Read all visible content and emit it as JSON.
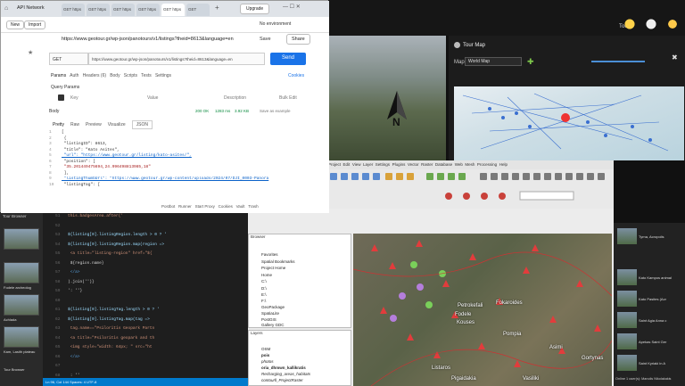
{
  "tour_app": {
    "tools_label": "Tools",
    "tour_map_title": "Tour Map",
    "map_label": "Map",
    "map_select_value": "World Map",
    "north_letter": "N"
  },
  "chrome": {
    "tabs": [
      "GET https",
      "GET https",
      "GET https",
      "GET https",
      "GET https",
      "GET"
    ],
    "workspace": "API Network",
    "new_label": "New",
    "import_label": "Import",
    "upgrade_label": "Upgrade",
    "env_label": "No environment"
  },
  "postman": {
    "request_title": "https://www.geotour.gr/wp-json/panotours/v1/listings?theid=8613&language=en",
    "save_label": "Save",
    "share_label": "Share",
    "method": "GET",
    "url": "https://www.geotour.gr/wp-json/panotours/v1/listings?theid=8613&language=en",
    "send_label": "Send",
    "tabs": [
      "Params",
      "Auth",
      "Headers (6)",
      "Body",
      "Scripts",
      "Tests",
      "Settings"
    ],
    "cookies_label": "Cookies",
    "query_params_label": "Query Params",
    "key_label": "Key",
    "value_label": "Value",
    "description_label": "Description",
    "bulk_edit_label": "Bulk Edit",
    "body_label": "Body",
    "status": "200 OK",
    "time": "1283 ms",
    "size": "3.92 KB",
    "save_example": "Save as example",
    "view_tabs": [
      "Pretty",
      "Raw",
      "Preview",
      "Visualize"
    ],
    "format": "JSON",
    "code_lines": [
      {
        "n": "1",
        "t": "["
      },
      {
        "n": "2",
        "t": "  {"
      },
      {
        "n": "3",
        "t": "    \"listingID\": 8613,"
      },
      {
        "n": "4",
        "t": "    \"title\": \"Kato Asites\","
      },
      {
        "n": "5",
        "t": "    \"url\": \"https://www.geotour.gr/listing/kato-asites/\","
      },
      {
        "n": "6",
        "t": "    \"position\": ["
      },
      {
        "n": "7",
        "t": "      \"35.201449475694,24.996498813985,18\""
      },
      {
        "n": "8",
        "t": "    ],"
      },
      {
        "n": "9",
        "t": "    \"listingThumbUrl\": \"https://www.geotour.gr/wp-content/uploads/2024/07/DJI_0003-Panora"
      },
      {
        "n": "10",
        "t": "    \"listingTag\": ["
      }
    ],
    "bottom_items": [
      "Postbot",
      "Runner",
      "Start Proxy",
      "Cookies",
      "Vault",
      "Trash"
    ]
  },
  "editor": {
    "tour_browser": "Tour Browser",
    "thumb_captions": [
      "",
      "Fodele archeolog",
      "Achlada",
      "Kam, Lasith plateau",
      "Tour Browser"
    ],
    "lines": [
      {
        "n": "51",
        "t": "this.badgesArea.after('"
      },
      {
        "n": "52",
        "t": ""
      },
      {
        "n": "53",
        "t": "${listing[0].listingRegion.length > 0 ? '"
      },
      {
        "n": "54",
        "t": "${listing[0].listingRegion.map(region =>"
      },
      {
        "n": "55",
        "t": "  <a title=\"listing-region\" href=\"${"
      },
      {
        "n": "56",
        "t": "  ${region.name}"
      },
      {
        "n": "57",
        "t": "  </a>"
      },
      {
        "n": "58",
        "t": ").join('')}"
      },
      {
        "n": "59",
        "t": "': ''}"
      },
      {
        "n": "60",
        "t": ""
      },
      {
        "n": "61",
        "t": "${listing[0].listingTag.length > 0 ? '"
      },
      {
        "n": "62",
        "t": "${listing[0].listingTag.map(tag =>"
      },
      {
        "n": "63",
        "t": "  tag.name==\"Psiloritis Geopark Partn"
      },
      {
        "n": "64",
        "t": "  <a title=\"Psiloritis geopark and th"
      },
      {
        "n": "65",
        "t": "  <img style=\"width: 64px; \" src=\"ht"
      },
      {
        "n": "66",
        "t": "  </a>"
      },
      {
        "n": "67",
        "t": ""
      },
      {
        "n": "68",
        "t": "  : ''"
      },
      {
        "n": "69",
        "t": ""
      },
      {
        "n": "70",
        "t": ").join('')}"
      },
      {
        "n": "71",
        "t": ""
      },
      {
        "n": "72",
        "t": "${listing[0].listingTag.length > 0 ? '"
      }
    ],
    "status": "Ln 96, Col 144   Spaces: 4   UTF-8"
  },
  "qgis": {
    "menu": [
      "Project",
      "Edit",
      "View",
      "Layer",
      "Settings",
      "Plugins",
      "Vector",
      "Raster",
      "Database",
      "Web",
      "Mesh",
      "Processing",
      "Help"
    ],
    "browser_title": "Browser",
    "browser_items": [
      "Favorites",
      "Spatial Bookmarks",
      "Project Home",
      "Home",
      "C:\\",
      "D:\\",
      "E:\\",
      "F:\\",
      "GeoPackage",
      "SpatiaLite",
      "PostGIS",
      "Gallery GDC"
    ],
    "layers_title": "Layers",
    "layers": [
      "OSM",
      "pois",
      "photos",
      "oria_dhmwn_kallikratis",
      "Recharging_areas_habitats",
      "contourll_ProjectRaster"
    ],
    "map_labels": [
      "Fodele",
      "Fokaroides",
      "Kouses",
      "Pompia",
      "Gortynas",
      "Listaros",
      "Pigaidakia",
      "Vasiliki",
      "Petrokefali",
      "Asimi"
    ]
  },
  "right_list": {
    "items": [
      "Tyrna, Acropolis",
      "Kato Kampos animal",
      "Kato Pasites (Acr",
      "Saint Agia Anna c",
      "Apekas Saint Ger",
      "Saint Kyriaki in A"
    ],
    "footer": "Online 1 user(s): Manolis Nikolakakis"
  }
}
